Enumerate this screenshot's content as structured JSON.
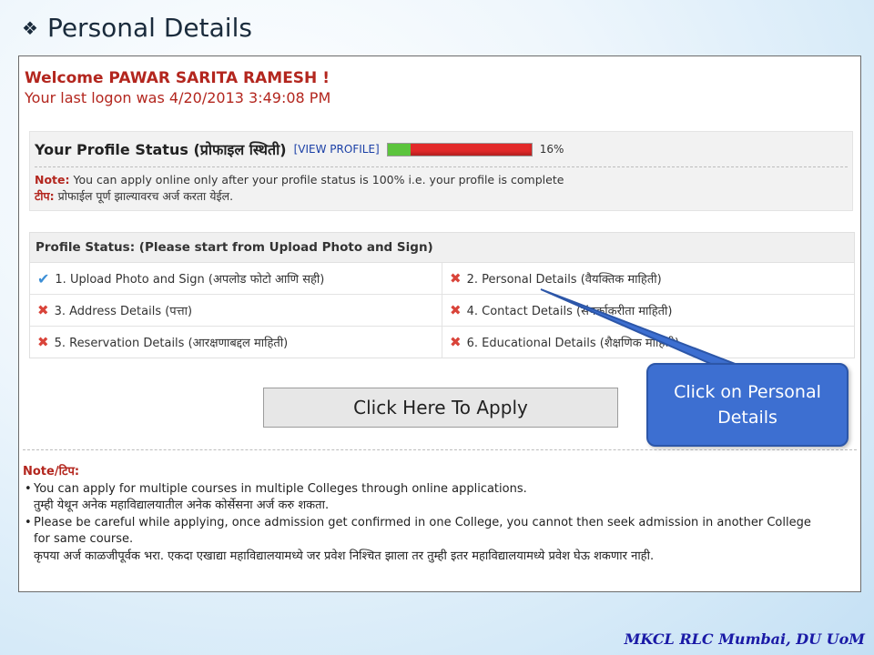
{
  "slide": {
    "title_icon": "diamond-bullet-icon",
    "title": "Personal Details",
    "footer": "MKCL RLC Mumbai, DU UoM"
  },
  "welcome": {
    "line1": "Welcome PAWAR SARITA RAMESH !",
    "line2": "Your last logon was 4/20/2013 3:49:08 PM"
  },
  "profile": {
    "title": "Your Profile Status (प्रोफाइल स्थिती)",
    "view_link": "[VIEW PROFILE]",
    "progress_percent": 16,
    "progress_label": "16%",
    "note_label": "Note:",
    "note_text": " You can apply online only after your profile status is 100% i.e. your profile is complete",
    "tip_label": "टीप:",
    "tip_text": " प्रोफाईल पूर्ण झाल्यावरच अर्ज करता येईल.",
    "colors": {
      "bar_red": "#e32a2a",
      "bar_green": "#5cc43d"
    }
  },
  "status_table": {
    "header": "Profile Status: (Please start from Upload Photo and Sign)",
    "rows": [
      [
        {
          "icon": "check-icon",
          "label": "1. Upload Photo and Sign (अपलोड फोटो आणि सही)"
        },
        {
          "icon": "cross-icon",
          "label": "2. Personal Details (वैयक्तिक माहिती)"
        }
      ],
      [
        {
          "icon": "cross-icon",
          "label": "3. Address Details (पत्ता)"
        },
        {
          "icon": "cross-icon",
          "label": "4. Contact Details (संपर्काकरीता माहिती)"
        }
      ],
      [
        {
          "icon": "cross-icon",
          "label": "5. Reservation Details (आरक्षणाबद्दल माहिती)"
        },
        {
          "icon": "cross-icon",
          "label": "6. Educational Details (शैक्षणिक माहिती)"
        }
      ]
    ]
  },
  "apply_button": "Click Here To Apply",
  "bottom_note": {
    "heading": "Note/टिप:",
    "b1_en": "You can apply for multiple courses in multiple Colleges through online applications.",
    "b1_mr": "तुम्ही येथून अनेक महाविद्यालयातील अनेक कोर्सेसना अर्ज करु शकता.",
    "b2_en_1": "Please be careful while applying, once admission get confirmed in one College, you cannot then seek admission in another College",
    "b2_en_2": "for same course.",
    "b2_mr": "कृपया अर्ज काळजीपूर्वक भरा. एकदा एखाद्या महाविद्यालयामध्ये जर प्रवेश निश्चित झाला तर तुम्ही इतर महाविद्यालयामध्ये प्रवेश घेऊ शकणार नाही."
  },
  "callout": {
    "text": "Click on Personal Details",
    "color": "#3d6fd1"
  }
}
